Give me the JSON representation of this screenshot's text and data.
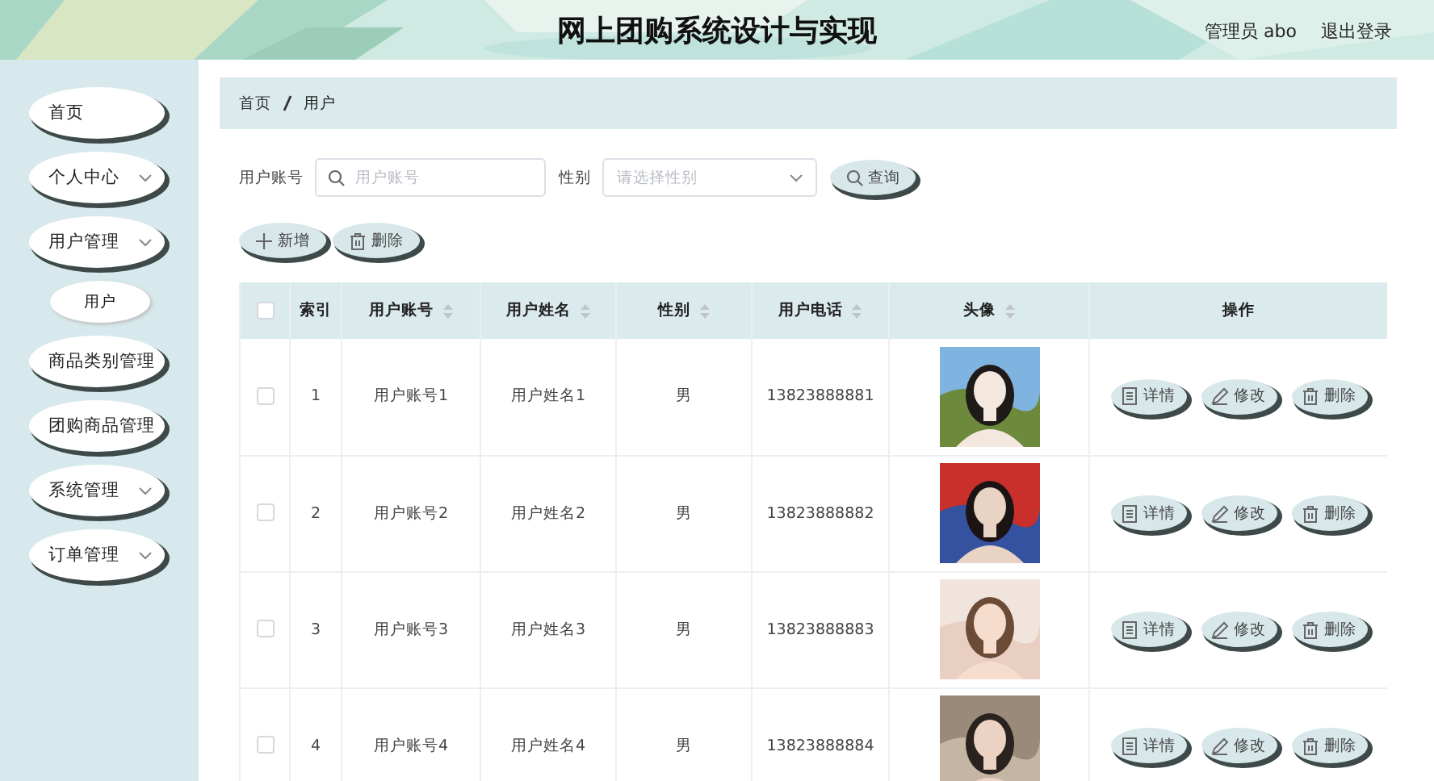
{
  "header": {
    "title": "网上团购系统设计与实现",
    "user": "管理员 abo",
    "logout": "退出登录"
  },
  "sidebar": {
    "items": [
      {
        "label": "首页",
        "expandable": false,
        "selected": false
      },
      {
        "label": "个人中心",
        "expandable": true,
        "selected": false
      },
      {
        "label": "用户管理",
        "expandable": true,
        "selected": false,
        "children": [
          {
            "label": "用户",
            "selected": true
          }
        ]
      },
      {
        "label": "商品类别管理",
        "expandable": false,
        "selected": false
      },
      {
        "label": "团购商品管理",
        "expandable": false,
        "selected": false
      },
      {
        "label": "系统管理",
        "expandable": true,
        "selected": false
      },
      {
        "label": "订单管理",
        "expandable": true,
        "selected": false
      }
    ]
  },
  "breadcrumb": [
    "首页",
    "用户"
  ],
  "search": {
    "fields": [
      {
        "kind": "text",
        "label": "用户账号",
        "placeholder": "用户账号"
      },
      {
        "kind": "select",
        "label": "性别",
        "placeholder": "请选择性别"
      }
    ],
    "button": "查询"
  },
  "actions": [
    {
      "kind": "add",
      "label": "新增"
    },
    {
      "kind": "delete",
      "label": "删除"
    }
  ],
  "table": {
    "columns": [
      {
        "label": "索引",
        "sortable": false
      },
      {
        "label": "用户账号",
        "sortable": true
      },
      {
        "label": "用户姓名",
        "sortable": true
      },
      {
        "label": "性别",
        "sortable": true
      },
      {
        "label": "用户电话",
        "sortable": true
      },
      {
        "label": "头像",
        "sortable": true
      },
      {
        "label": "操作",
        "sortable": false
      }
    ],
    "header_checked": false,
    "rows": [
      {
        "checked": false,
        "cells": [
          "1",
          "用户账号1",
          "用户姓名1",
          "男",
          "13823888881"
        ],
        "avatar": {
          "kind": "picture"
        },
        "actions": [
          {
            "kind": "detail",
            "label": "详情"
          },
          {
            "kind": "edit",
            "label": "修改"
          },
          {
            "kind": "delete",
            "label": "删除"
          }
        ]
      },
      {
        "checked": false,
        "cells": [
          "2",
          "用户账号2",
          "用户姓名2",
          "男",
          "13823888882"
        ],
        "avatar": {
          "kind": "picture"
        },
        "actions": [
          {
            "kind": "detail",
            "label": "详情"
          },
          {
            "kind": "edit",
            "label": "修改"
          },
          {
            "kind": "delete",
            "label": "删除"
          }
        ]
      },
      {
        "checked": false,
        "cells": [
          "3",
          "用户账号3",
          "用户姓名3",
          "男",
          "13823888883"
        ],
        "avatar": {
          "kind": "picture"
        },
        "actions": [
          {
            "kind": "detail",
            "label": "详情"
          },
          {
            "kind": "edit",
            "label": "修改"
          },
          {
            "kind": "delete",
            "label": "删除"
          }
        ]
      },
      {
        "checked": false,
        "cells": [
          "4",
          "用户账号4",
          "用户姓名4",
          "男",
          "13823888884"
        ],
        "avatar": {
          "kind": "picture"
        },
        "actions": [
          {
            "kind": "detail",
            "label": "详情"
          },
          {
            "kind": "edit",
            "label": "修改"
          },
          {
            "kind": "delete",
            "label": "删除"
          }
        ]
      }
    ]
  }
}
